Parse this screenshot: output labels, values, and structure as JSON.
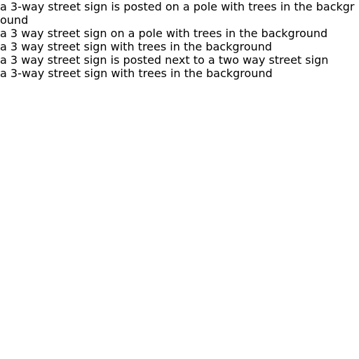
{
  "captions": [
    "a 3-way street sign is posted on a pole with trees in the background",
    "a 3 way street sign on a pole with trees in the background",
    "a 3 way street sign with trees in the background",
    "a 3 way street sign is posted next to a two way street sign",
    "a 3-way street sign with trees in the background"
  ]
}
